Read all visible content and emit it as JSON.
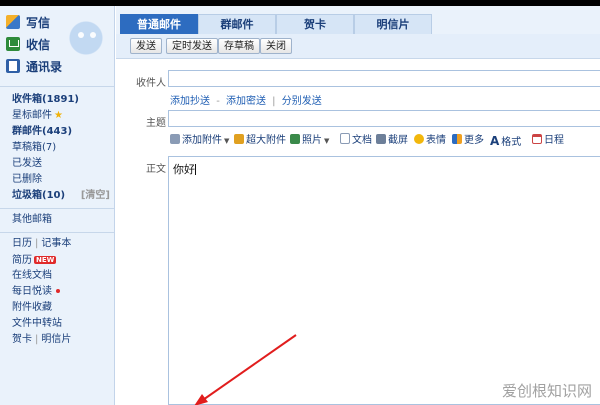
{
  "sidebar": {
    "top_actions": [
      {
        "label": "写信",
        "icon": "pen-icon"
      },
      {
        "label": "收信",
        "icon": "inbox-icon"
      },
      {
        "label": "通讯录",
        "icon": "address-book-icon"
      }
    ],
    "folders": [
      {
        "label": "收件箱(1891)",
        "bold": true
      },
      {
        "label": "星标邮件",
        "star": true
      },
      {
        "label": "群邮件(443)",
        "bold": true
      },
      {
        "label": "草稿箱(7)"
      },
      {
        "label": "已发送"
      },
      {
        "label": "已删除"
      },
      {
        "label": "垃圾箱(10)",
        "bold": true,
        "clear_label": "[清空]"
      }
    ],
    "other_label": "其他邮箱",
    "tools": {
      "calendar": "日历",
      "notes": "记事本",
      "resume": "简历",
      "resume_badge": "NEW",
      "online_docs": "在线文档",
      "daily_read": "每日悦读",
      "attachments": "附件收藏",
      "file_transfer": "文件中转站",
      "greeting_card": "贺卡",
      "postcard": "明信片"
    }
  },
  "tabs": [
    "普通邮件",
    "群邮件",
    "贺卡",
    "明信片"
  ],
  "active_tab": 0,
  "toolbar": {
    "send": "发送",
    "schedule_send": "定时发送",
    "save_draft": "存草稿",
    "close": "关闭"
  },
  "compose": {
    "to_label": "收件人",
    "add_cc": "添加抄送",
    "add_bcc": "添加密送",
    "separate_send": "分别发送",
    "subject_label": "主题",
    "body_label": "正文",
    "body_text": "你好"
  },
  "format_bar": {
    "attach": "添加附件",
    "large_attach": "超大附件",
    "photo": "照片",
    "doc": "文档",
    "screenshot": "截屏",
    "emoji": "表情",
    "more": "更多",
    "format": "格式",
    "schedule": "日程"
  },
  "watermark": "爱创根知识网",
  "colors": {
    "accent": "#2d6cc0",
    "sidebar_bg": "#eaf2fb",
    "link": "#1f5eb3",
    "arrow": "#e11d1d"
  }
}
